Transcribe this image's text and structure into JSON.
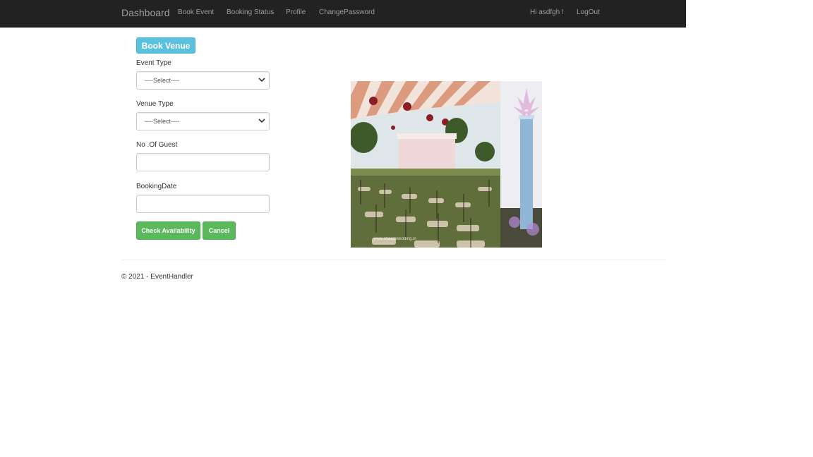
{
  "navbar": {
    "brand": "Dashboard",
    "links": [
      {
        "label": "Book Event"
      },
      {
        "label": "Booking Status"
      },
      {
        "label": "Profile"
      },
      {
        "label": "ChangePassword"
      }
    ],
    "greeting": "Hi asdfgh !",
    "logout": "LogOut",
    "colors": {
      "background": "#222222",
      "link": "#9d9d9d"
    }
  },
  "form": {
    "heading_button": "Book Venue",
    "event_type": {
      "label": "Event Type",
      "selected": "----Select----"
    },
    "venue_type": {
      "label": "Venue Type",
      "selected": "----Select----"
    },
    "guests": {
      "label": "No .Of Guest",
      "value": ""
    },
    "booking_date": {
      "label": "BookingDate",
      "value": ""
    },
    "check_button": "Check Availability",
    "cancel_button": "Cancel",
    "colors": {
      "info": "#5bc0de",
      "success": "#5cb85c"
    }
  },
  "image": {
    "description": "venue-photo",
    "watermark": "www.shaadiwedding.in"
  },
  "footer": {
    "text": "© 2021 - EventHandler"
  }
}
